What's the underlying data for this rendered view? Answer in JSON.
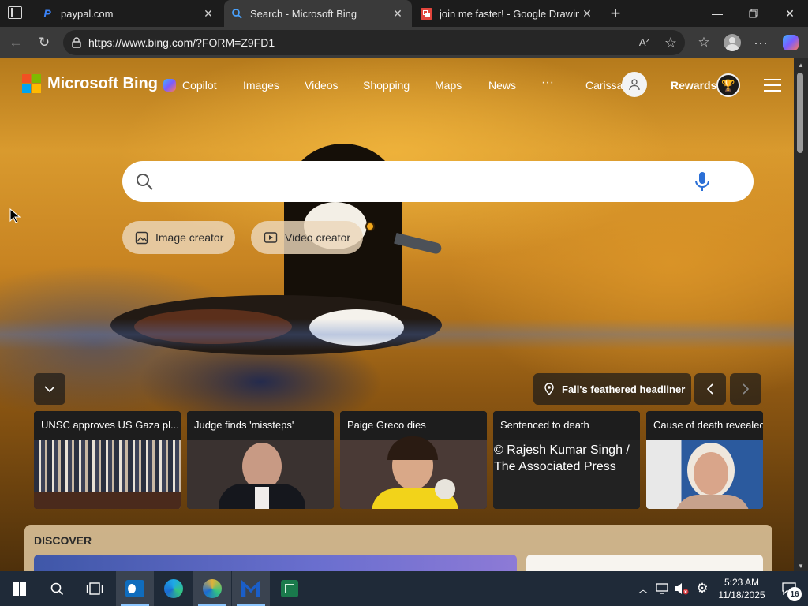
{
  "browser": {
    "tabs": [
      {
        "title": "paypal.com",
        "icon": "paypal-icon",
        "active": false
      },
      {
        "title": "Search - Microsoft Bing",
        "icon": "search-icon",
        "active": true
      },
      {
        "title": "join me faster! - Google Drawings",
        "icon": "google-drawings-icon",
        "active": false
      }
    ],
    "url": "https://www.bing.com/?FORM=Z9FD1"
  },
  "bing": {
    "logo_text": "Microsoft Bing",
    "nav": {
      "copilot": "Copilot",
      "images": "Images",
      "videos": "Videos",
      "shopping": "Shopping",
      "maps": "Maps",
      "news": "News",
      "more": "···"
    },
    "user_name": "Carissa",
    "rewards_label": "Rewards",
    "search_placeholder": "",
    "image_creator": "Image creator",
    "video_creator": "Video creator",
    "headline_label": "Fall's feathered headliner",
    "news_cards": [
      {
        "title": "UNSC approves US Gaza pl..."
      },
      {
        "title": "Judge finds 'missteps'"
      },
      {
        "title": "Paige Greco dies"
      },
      {
        "title": "Sentenced to death",
        "alt_text": "© Rajesh Kumar Singh / The Associated Press"
      },
      {
        "title": "Cause of death revealed"
      }
    ],
    "discover_label": "DISCOVER"
  },
  "taskbar": {
    "apps": [
      "outlook-icon",
      "edge-icon",
      "edge-canary-icon",
      "malwarebytes-icon",
      "sheets-icon"
    ],
    "time": "5:23 AM",
    "date": "11/18/2025",
    "notification_count": "16"
  },
  "colors": {
    "accent_blue": "#8cc6ff",
    "ms_red": "#f25022",
    "ms_green": "#7fba00",
    "ms_blue": "#00a4ef",
    "ms_yellow": "#ffb900"
  }
}
